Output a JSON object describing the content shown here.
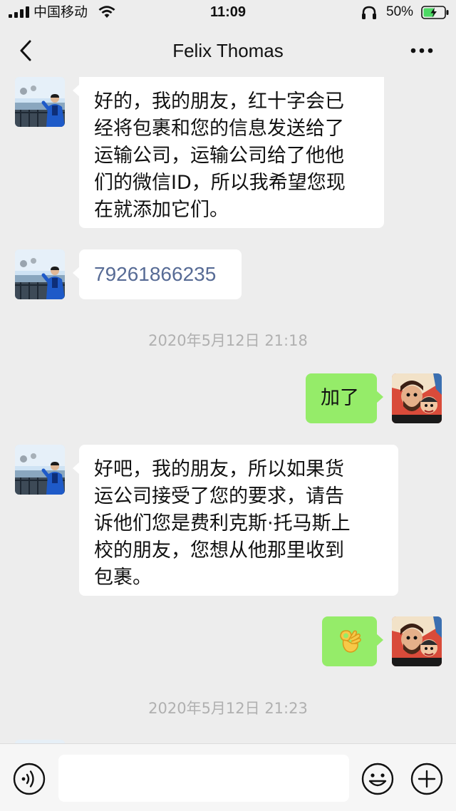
{
  "status_bar": {
    "carrier": "中国移动",
    "time": "11:09",
    "battery_percent": "50%",
    "icons": [
      "signal-icon",
      "wifi-icon",
      "headphone-icon",
      "battery-icon"
    ]
  },
  "nav": {
    "title": "Felix Thomas",
    "icons": [
      "back-icon",
      "more-icon"
    ]
  },
  "messages": [
    {
      "from": "contact",
      "text": "好的，我的朋友，红十字会已\n经将包裹和您的信息发送给了\n运输公司，运输公司给了他他\n们的微信ID，所以我希望您现\n在就添加它们。"
    },
    {
      "from": "contact",
      "text": "79261866235"
    },
    {
      "timestamp": "2020年5月12日 21:18"
    },
    {
      "from": "me",
      "text": "加了"
    },
    {
      "from": "contact",
      "text": "好吧，我的朋友，所以如果货\n运公司接受了您的要求，请告\n诉他们您是费利克斯·托马斯上\n校的朋友，您想从他那里收到\n包裹。"
    },
    {
      "from": "me",
      "emoji": "ok-hand-emoji"
    },
    {
      "timestamp": "2020年5月12日 21:23"
    }
  ],
  "input_bar": {
    "placeholder": "",
    "icons": [
      "voice-icon",
      "emoji-icon",
      "plus-icon"
    ]
  },
  "colors": {
    "background": "#EDEDED",
    "incoming_bubble": "#FFFFFF",
    "outgoing_bubble": "#95EC69",
    "link": "#576B95",
    "timestamp": "#B0B0B0"
  }
}
